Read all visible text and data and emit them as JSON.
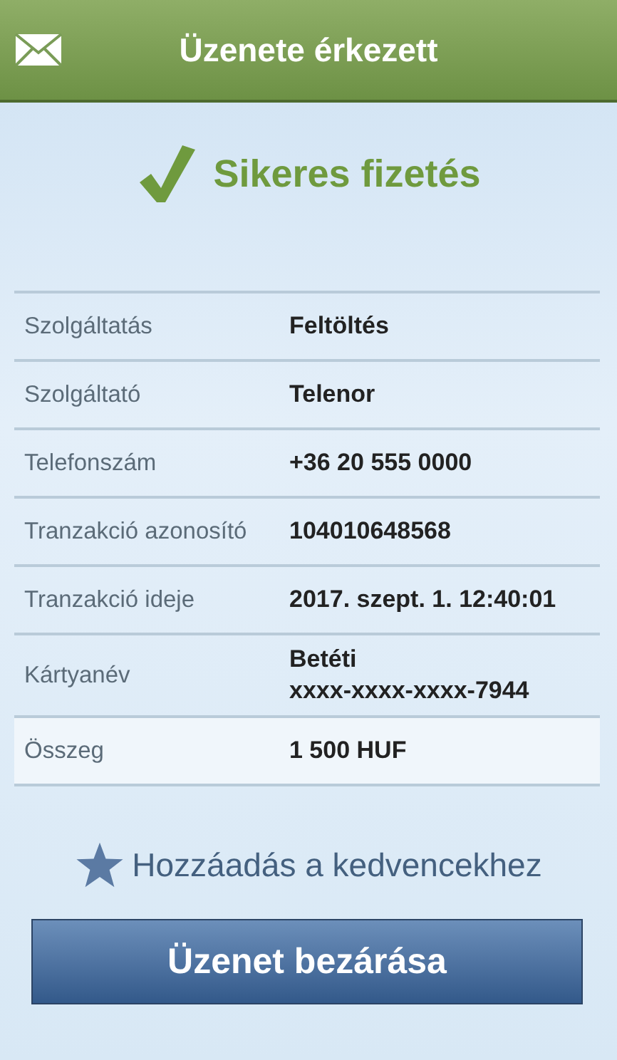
{
  "header": {
    "title": "Üzenete érkezett"
  },
  "status": {
    "kind": "success",
    "text": "Sikeres fizetés"
  },
  "rows": [
    {
      "label": "Szolgáltatás",
      "value": [
        "Feltöltés"
      ],
      "highlighted": false
    },
    {
      "label": "Szolgáltató",
      "value": [
        "Telenor"
      ],
      "highlighted": false
    },
    {
      "label": "Telefonszám",
      "value": [
        "+36 20 555 0000"
      ],
      "highlighted": false
    },
    {
      "label": "Tranzakció azonosító",
      "value": [
        "104010648568"
      ],
      "highlighted": false
    },
    {
      "label": "Tranzakció ideje",
      "value": [
        "2017. szept. 1. 12:40:01"
      ],
      "highlighted": false
    },
    {
      "label": "Kártyanév",
      "value": [
        "Betéti",
        "xxxx-xxxx-xxxx-7944"
      ],
      "highlighted": false
    },
    {
      "label": "Összeg",
      "value": [
        "1 500 HUF"
      ],
      "highlighted": true
    }
  ],
  "favorite_link": "Hozzáadás a kedvencekhez",
  "close_button": "Üzenet bezárása"
}
